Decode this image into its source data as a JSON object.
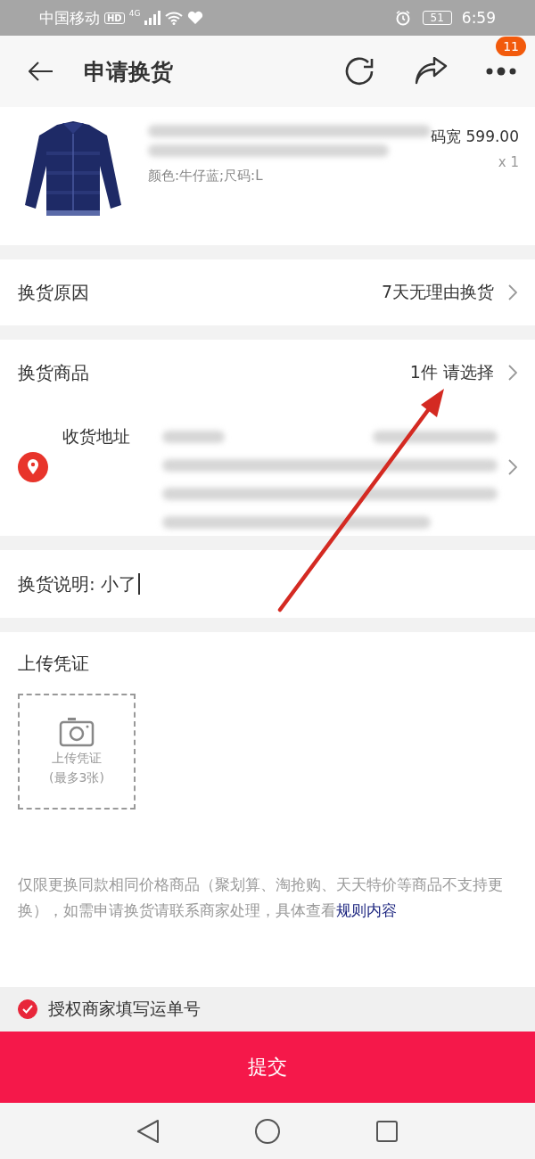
{
  "status_bar": {
    "carrier": "中国移动",
    "hd": "HD",
    "network": "4G",
    "battery": "51",
    "time": "6:59"
  },
  "header": {
    "title": "申请换货",
    "badge": "11"
  },
  "product": {
    "price": "码宽 599.00",
    "quantity": "x 1",
    "spec": "颜色:牛仔蓝;尺码:L"
  },
  "reason": {
    "label": "换货原因",
    "value": "7天无理由换货"
  },
  "goods": {
    "label": "换货商品",
    "value": "1件 请选择"
  },
  "address": {
    "label": "收货地址"
  },
  "note": {
    "label": "换货说明:",
    "value": "小了"
  },
  "upload": {
    "title": "上传凭证",
    "box_lines": [
      "上传凭证",
      "(最多3张)"
    ]
  },
  "notice": {
    "text": "仅限更换同款相同价格商品（聚划算、淘抢购、天天特价等商品不支持更换），如需申请换货请联系商家处理，具体查看",
    "link": "规则内容"
  },
  "authorize": {
    "label": "授权商家填写运单号",
    "checked": true
  },
  "submit": {
    "label": "提交"
  }
}
